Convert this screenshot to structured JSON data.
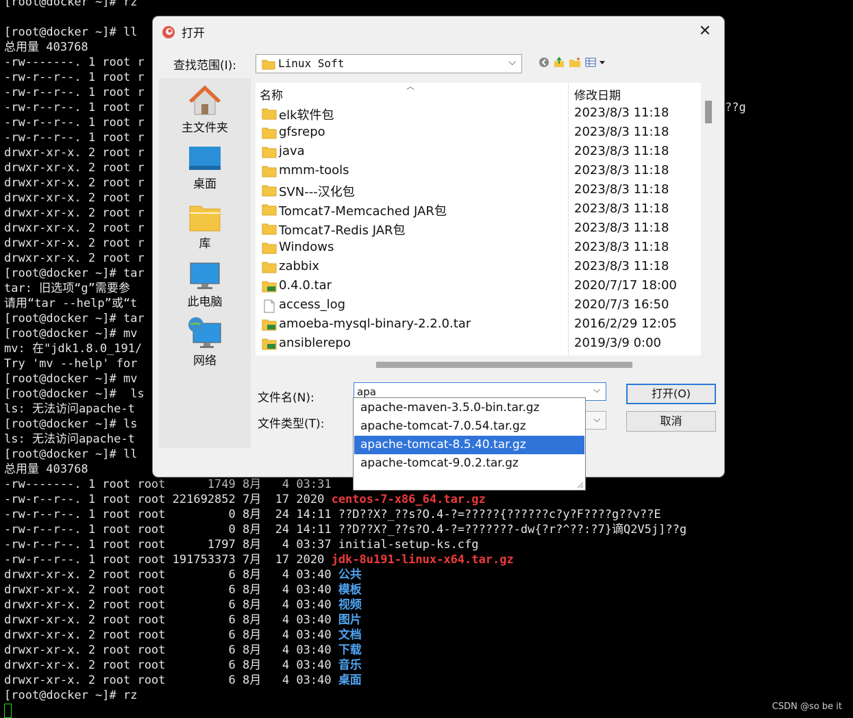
{
  "terminal": {
    "lines": [
      {
        "text": "[root@docker ~]# rz"
      },
      {
        "text": ""
      },
      {
        "text": "[root@docker ~]# ll"
      },
      {
        "text": "总用量 403768"
      },
      {
        "text": "-rw-------. 1 root r"
      },
      {
        "text": "-rw-r--r--. 1 root r"
      },
      {
        "text": "-rw-r--r--. 1 root r"
      },
      {
        "text": "-rw-r--r--. 1 root r",
        "tail": "??g"
      },
      {
        "text": "-rw-r--r--. 1 root r"
      },
      {
        "text": "-rw-r--r--. 1 root r"
      },
      {
        "text": "drwxr-xr-x. 2 root r"
      },
      {
        "text": "drwxr-xr-x. 2 root r"
      },
      {
        "text": "drwxr-xr-x. 2 root r"
      },
      {
        "text": "drwxr-xr-x. 2 root r"
      },
      {
        "text": "drwxr-xr-x. 2 root r"
      },
      {
        "text": "drwxr-xr-x. 2 root r"
      },
      {
        "text": "drwxr-xr-x. 2 root r"
      },
      {
        "text": "drwxr-xr-x. 2 root r"
      },
      {
        "text": "[root@docker ~]# tar"
      },
      {
        "text": "tar: 旧选项“g”需要参"
      },
      {
        "text": "请用“tar --help”或“t"
      },
      {
        "text": "[root@docker ~]# tar"
      },
      {
        "text": "[root@docker ~]# mv"
      },
      {
        "text": "mv: 在\"jdk1.8.0_191/"
      },
      {
        "text": "Try 'mv --help' for"
      },
      {
        "text": "[root@docker ~]# mv"
      },
      {
        "text": "[root@docker ~]#  ls"
      },
      {
        "text": "ls: 无法访问apache-t"
      },
      {
        "text": "[root@docker ~]# ls"
      },
      {
        "text": "ls: 无法访问apache-t"
      },
      {
        "text": "[root@docker ~]# ll"
      },
      {
        "text": "总用量 403768"
      },
      {
        "text": "-rw-------. 1 root root      1749 8月   4 03:31"
      },
      {
        "text": "-rw-r--r--. 1 root root 221692852 7月  17 2020 ",
        "colored": "centos-7-x86_64.tar.gz",
        "color": "red"
      },
      {
        "text": "-rw-r--r--. 1 root root         0 8月  24 14:11 ??D??X?_??s?O.4-?=?????{??????c?y?F????g??v??E"
      },
      {
        "text": "-rw-r--r--. 1 root root         0 8月  24 14:11 ??D??X?_??s?O.4-?=???????-dw{?r?^??:?7}谪Q2V5j]??g"
      },
      {
        "text": "-rw-r--r--. 1 root root      1797 8月   4 03:37 initial-setup-ks.cfg"
      },
      {
        "text": "-rw-r--r--. 1 root root 191753373 7月  17 2020 ",
        "colored": "jdk-8u191-linux-x64.tar.gz",
        "color": "red"
      },
      {
        "text": "drwxr-xr-x. 2 root root         6 8月   4 03:40 ",
        "colored": "公共",
        "color": "blue"
      },
      {
        "text": "drwxr-xr-x. 2 root root         6 8月   4 03:40 ",
        "colored": "模板",
        "color": "blue"
      },
      {
        "text": "drwxr-xr-x. 2 root root         6 8月   4 03:40 ",
        "colored": "视频",
        "color": "blue"
      },
      {
        "text": "drwxr-xr-x. 2 root root         6 8月   4 03:40 ",
        "colored": "图片",
        "color": "blue"
      },
      {
        "text": "drwxr-xr-x. 2 root root         6 8月   4 03:40 ",
        "colored": "文档",
        "color": "blue"
      },
      {
        "text": "drwxr-xr-x. 2 root root         6 8月   4 03:40 ",
        "colored": "下载",
        "color": "blue"
      },
      {
        "text": "drwxr-xr-x. 2 root root         6 8月   4 03:40 ",
        "colored": "音乐",
        "color": "blue"
      },
      {
        "text": "drwxr-xr-x. 2 root root         6 8月   4 03:40 ",
        "colored": "桌面",
        "color": "blue"
      },
      {
        "text": "[root@docker ~]# rz"
      }
    ],
    "watermark": "CSDN @so be it"
  },
  "dialog": {
    "title": "打开",
    "close_glyph": "✕",
    "look_in_label": "查找范围(I):",
    "look_in_value": "Linux Soft",
    "places": [
      {
        "label": "主文件夹",
        "icon": "home-icon"
      },
      {
        "label": "桌面",
        "icon": "desktop-icon"
      },
      {
        "label": "库",
        "icon": "library-icon"
      },
      {
        "label": "此电脑",
        "icon": "computer-icon"
      },
      {
        "label": "网络",
        "icon": "network-icon"
      }
    ],
    "columns": {
      "name": "名称",
      "date": "修改日期"
    },
    "files": [
      {
        "name": "elk软件包",
        "date": "2023/8/3 11:18",
        "type": "folder"
      },
      {
        "name": "gfsrepo",
        "date": "2023/8/3 11:18",
        "type": "folder"
      },
      {
        "name": "java",
        "date": "2023/8/3 11:18",
        "type": "folder"
      },
      {
        "name": "mmm-tools",
        "date": "2023/8/3 11:18",
        "type": "folder"
      },
      {
        "name": "SVN---汉化包",
        "date": "2023/8/3 11:18",
        "type": "folder"
      },
      {
        "name": "Tomcat7-Memcached JAR包",
        "date": "2023/8/3 11:18",
        "type": "folder"
      },
      {
        "name": "Tomcat7-Redis JAR包",
        "date": "2023/8/3 11:18",
        "type": "folder"
      },
      {
        "name": "Windows",
        "date": "2023/8/3 11:18",
        "type": "folder"
      },
      {
        "name": "zabbix",
        "date": "2023/8/3 11:18",
        "type": "folder"
      },
      {
        "name": "0.4.0.tar",
        "date": "2020/7/17 18:00",
        "type": "archive"
      },
      {
        "name": "access_log",
        "date": "2020/7/3 16:50",
        "type": "file"
      },
      {
        "name": "amoeba-mysql-binary-2.2.0.tar",
        "date": "2016/2/29 12:05",
        "type": "archive"
      },
      {
        "name": "ansiblerepo",
        "date": "2019/3/9 0:00",
        "type": "archive"
      }
    ],
    "file_name_label": "文件名(N):",
    "file_name_value": "apa",
    "file_type_label": "文件类型(T):",
    "open_button": "打开(O)",
    "cancel_button": "取消",
    "autocomplete": [
      {
        "text": "apache-maven-3.5.0-bin.tar.gz",
        "selected": false
      },
      {
        "text": "apache-tomcat-7.0.54.tar.gz",
        "selected": false
      },
      {
        "text": "apache-tomcat-8.5.40.tar.gz",
        "selected": true
      },
      {
        "text": "apache-tomcat-9.0.2.tar.gz",
        "selected": false
      }
    ]
  },
  "colors": {
    "terminal_bg": "#000000",
    "terminal_fg": "#e6e6e6",
    "archive_red": "#ef3b3b",
    "dir_blue": "#4fa3f0",
    "selection_blue": "#3074d9",
    "cursor_green": "#26d926"
  }
}
